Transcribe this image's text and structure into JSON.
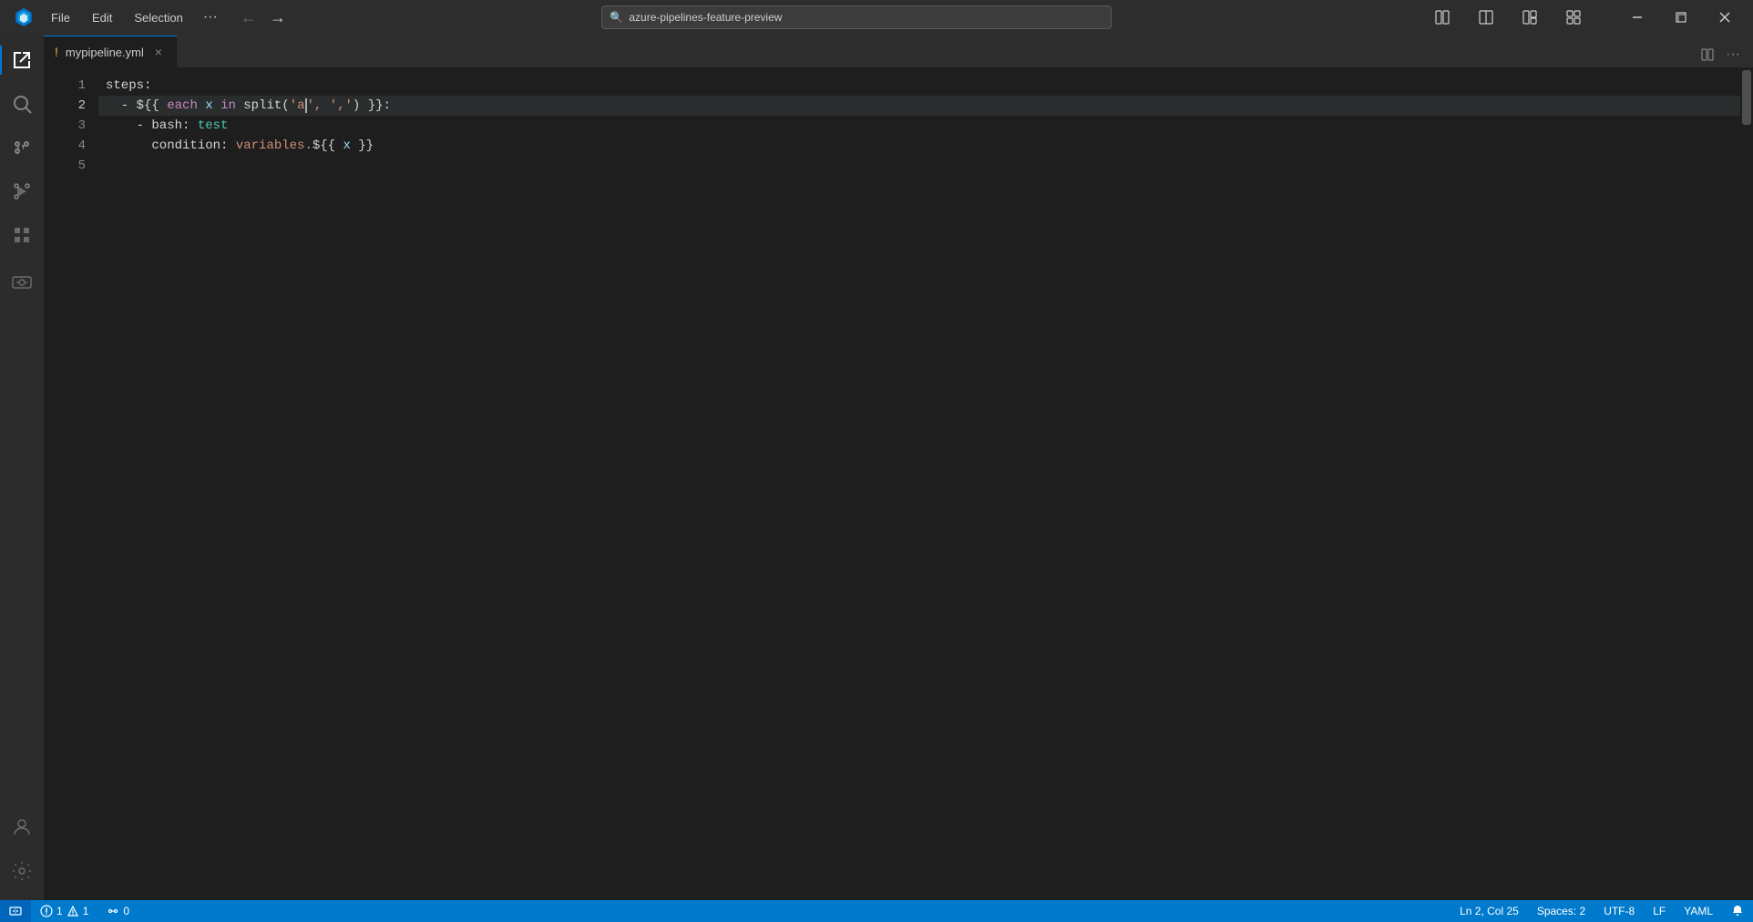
{
  "titlebar": {
    "menus": [
      "File",
      "Edit",
      "Selection",
      "···"
    ],
    "search_placeholder": "azure-pipelines-feature-preview",
    "nav_back": "←",
    "nav_forward": "→"
  },
  "activity_bar": {
    "icons": [
      {
        "name": "files-icon",
        "symbol": "⧉",
        "active": true
      },
      {
        "name": "search-icon",
        "symbol": "🔍",
        "active": false
      },
      {
        "name": "source-control-icon",
        "symbol": "⑂",
        "active": false
      },
      {
        "name": "run-debug-icon",
        "symbol": "▷",
        "active": false
      },
      {
        "name": "extensions-icon",
        "symbol": "⊞",
        "active": false
      },
      {
        "name": "remote-explorer-icon",
        "symbol": "⊙",
        "active": false
      }
    ],
    "bottom_icons": [
      {
        "name": "accounts-icon",
        "symbol": "👤"
      },
      {
        "name": "settings-icon",
        "symbol": "⚙"
      }
    ]
  },
  "editor": {
    "tab_label": "mypipeline.yml",
    "tab_modified": "!",
    "lines": [
      {
        "number": "1",
        "tokens": [
          {
            "text": "steps",
            "class": "t-white"
          },
          {
            "text": ":",
            "class": "t-white"
          }
        ]
      },
      {
        "number": "2",
        "active": true,
        "tokens": [
          {
            "text": "  - ",
            "class": "t-white"
          },
          {
            "text": "${{",
            "class": "t-white"
          },
          {
            "text": " each",
            "class": "t-purple"
          },
          {
            "text": " x ",
            "class": "t-lightblue"
          },
          {
            "text": "in",
            "class": "t-purple"
          },
          {
            "text": " split(",
            "class": "t-white"
          },
          {
            "text": "'a",
            "class": "t-string"
          },
          {
            "text": "CURSOR",
            "class": "cursor"
          },
          {
            "text": "', ','",
            "class": "t-string"
          },
          {
            "text": ") }}:",
            "class": "t-white"
          }
        ]
      },
      {
        "number": "3",
        "tokens": [
          {
            "text": "    - bash: ",
            "class": "t-white"
          },
          {
            "text": "test",
            "class": "t-cyan"
          }
        ]
      },
      {
        "number": "4",
        "tokens": [
          {
            "text": "      condition: ",
            "class": "t-white"
          },
          {
            "text": "variables.",
            "class": "t-orange"
          },
          {
            "text": "${{",
            "class": "t-white"
          },
          {
            "text": " x ",
            "class": "t-lightblue"
          },
          {
            "text": "}}",
            "class": "t-white"
          }
        ]
      },
      {
        "number": "5",
        "tokens": []
      }
    ]
  },
  "status_bar": {
    "errors": "1",
    "warnings": "1",
    "remote": "0",
    "position": "Ln 2, Col 25",
    "spaces": "Spaces: 2",
    "encoding": "UTF-8",
    "line_ending": "LF",
    "language": "YAML",
    "notifications": "🔔"
  }
}
